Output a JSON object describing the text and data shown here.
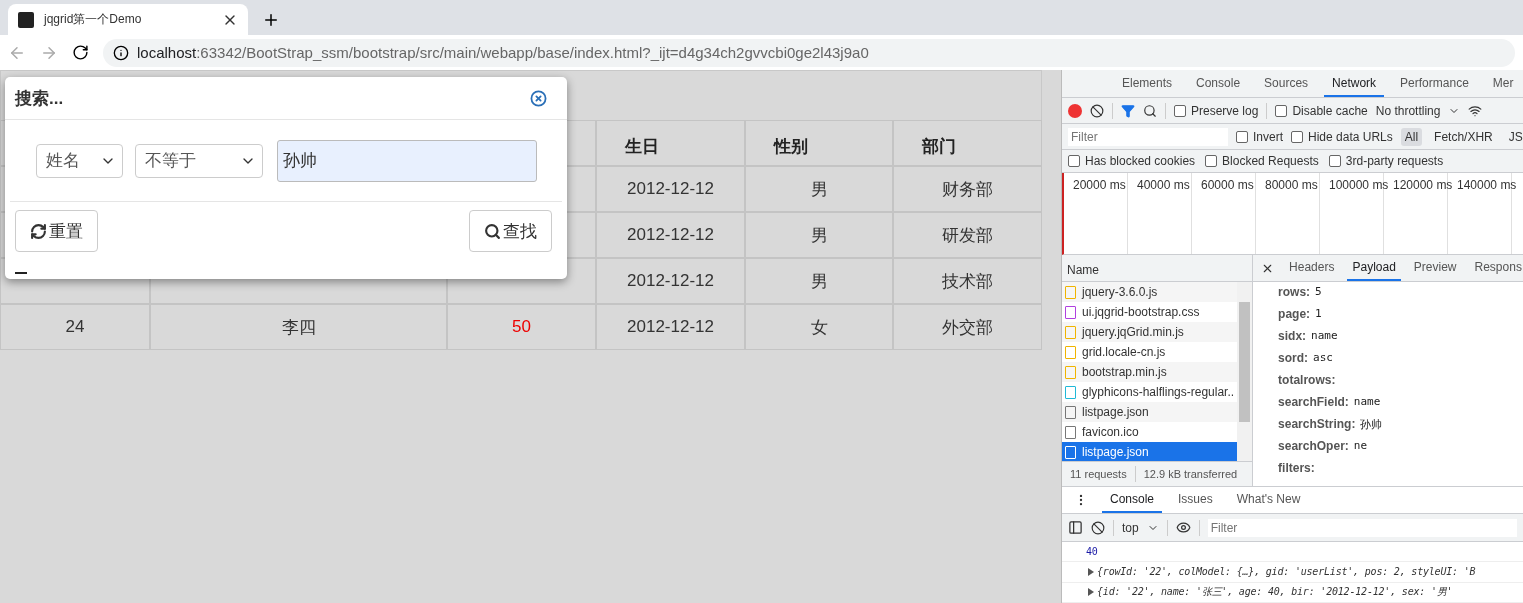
{
  "browser": {
    "tab_title": "jqgrid第一个Demo",
    "url_host": "localhost",
    "url_rest": ":63342/BootStrap_ssm/bootstrap/src/main/webapp/base/index.html?_ijt=d4g34ch2gvvcbi0ge2l43j9a0"
  },
  "grid": {
    "columns": [
      {},
      {},
      {},
      {
        "label": "生日"
      },
      {
        "label": "性别"
      },
      {
        "label": "部门"
      }
    ],
    "rows": [
      {
        "cells": [
          null,
          null,
          null,
          "2012-12-12",
          "男",
          "财务部"
        ]
      },
      {
        "cells": [
          null,
          null,
          null,
          "2012-12-12",
          "男",
          "研发部"
        ]
      },
      {
        "cells": [
          null,
          null,
          null,
          "2012-12-12",
          "男",
          "技术部"
        ]
      },
      {
        "cells": [
          "24",
          "李四",
          "50",
          "2012-12-12",
          "女",
          "外交部"
        ]
      }
    ]
  },
  "search_dialog": {
    "title": "搜索...",
    "field": "姓名",
    "operator": "不等于",
    "value": "孙帅",
    "reset_button": "重置",
    "find_button": "查找"
  },
  "devtools": {
    "tabs": [
      {
        "label": "Elements",
        "selected": false
      },
      {
        "label": "Console",
        "selected": false
      },
      {
        "label": "Sources",
        "selected": false
      },
      {
        "label": "Network",
        "selected": true
      },
      {
        "label": "Performance",
        "selected": false
      },
      {
        "label": "Mer",
        "selected": false
      }
    ],
    "preserve_log": {
      "label": "Preserve log",
      "checked": false
    },
    "disable_cache": {
      "label": "Disable cache",
      "checked": false
    },
    "throttling": "No throttling",
    "filter_placeholder": "Filter",
    "invert": {
      "label": "Invert",
      "checked": false
    },
    "hide_data_urls": {
      "label": "Hide data URLs",
      "checked": false
    },
    "type_filters": [
      {
        "label": "All",
        "selected": true
      },
      {
        "label": "Fetch/XHR",
        "selected": false
      },
      {
        "label": "JS",
        "selected": false
      }
    ],
    "extra_filters": [
      {
        "label": "Has blocked cookies",
        "checked": false
      },
      {
        "label": "Blocked Requests",
        "checked": false
      },
      {
        "label": "3rd-party requests",
        "checked": false
      }
    ],
    "timeline": [
      "20000 ms",
      "40000 ms",
      "60000 ms",
      "80000 ms",
      "100000 ms",
      "120000 ms",
      "140000 ms"
    ],
    "name_header": "Name",
    "requests": [
      {
        "name": "jquery-3.6.0.js",
        "kind": "script",
        "selected": false
      },
      {
        "name": "ui.jqgrid-bootstrap.css",
        "kind": "style",
        "selected": false
      },
      {
        "name": "jquery.jqGrid.min.js",
        "kind": "script",
        "selected": false
      },
      {
        "name": "grid.locale-cn.js",
        "kind": "script",
        "selected": false
      },
      {
        "name": "bootstrap.min.js",
        "kind": "script",
        "selected": false
      },
      {
        "name": "glyphicons-halflings-regular..",
        "kind": "font",
        "selected": false
      },
      {
        "name": "listpage.json",
        "kind": "doc",
        "selected": false
      },
      {
        "name": "favicon.ico",
        "kind": "doc",
        "selected": false
      },
      {
        "name": "listpage.json",
        "kind": "doc",
        "selected": true
      }
    ],
    "summary": [
      "11 requests",
      "12.9 kB transferred"
    ],
    "detail_tabs": [
      {
        "label": "Headers",
        "selected": false
      },
      {
        "label": "Payload",
        "selected": true
      },
      {
        "label": "Preview",
        "selected": false
      },
      {
        "label": "Respons",
        "selected": false
      }
    ],
    "payload": [
      {
        "key": "rows:",
        "value": "5"
      },
      {
        "key": "page:",
        "value": "1"
      },
      {
        "key": "sidx:",
        "value": "name"
      },
      {
        "key": "sord:",
        "value": "asc"
      },
      {
        "key": "totalrows:"
      },
      {
        "key": "searchField:",
        "value": "name"
      },
      {
        "key": "searchString:",
        "value": "孙帅"
      },
      {
        "key": "searchOper:",
        "value": "ne"
      },
      {
        "key": "filters:"
      }
    ],
    "drawer_tabs": [
      {
        "label": "Console",
        "selected": true
      },
      {
        "label": "Issues",
        "selected": false
      },
      {
        "label": "What's New",
        "selected": false
      }
    ],
    "context": "top",
    "console_filter_placeholder": "Filter",
    "logs": [
      {
        "kind": "number",
        "text": "40"
      },
      {
        "kind": "object",
        "text": "{rowId: '22', colModel: {…}, gid: 'userList', pos: 2, styleUI: 'B"
      },
      {
        "kind": "object",
        "text": "{id: '22', name: '张三', age: 40, bir: '2012-12-12', sex: '男'"
      }
    ]
  }
}
